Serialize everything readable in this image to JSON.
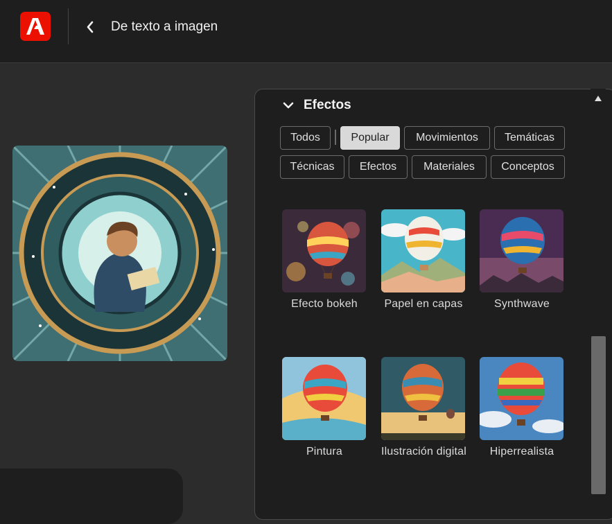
{
  "header": {
    "title": "De texto a imagen",
    "logo_icon": "adobe-firefly-logo-icon",
    "back_icon": "chevron-left-icon"
  },
  "panel": {
    "section_title": "Efectos",
    "section_icon": "chevron-down-icon",
    "filters": [
      "Todos",
      "Popular",
      "Movimientos",
      "Temáticas",
      "Técnicas",
      "Efectos",
      "Materiales",
      "Conceptos"
    ],
    "active_filter": "Popular",
    "effects": [
      "Efecto bokeh",
      "Papel en capas",
      "Synthwave",
      "Pintura",
      "Ilustración digital",
      "Hiperrealista"
    ]
  },
  "colors": {
    "brand_red": "#eb1000",
    "background": "#2c2c2c",
    "panel_bg": "#1e1e1e",
    "chip_active": "#d9d9d9"
  }
}
